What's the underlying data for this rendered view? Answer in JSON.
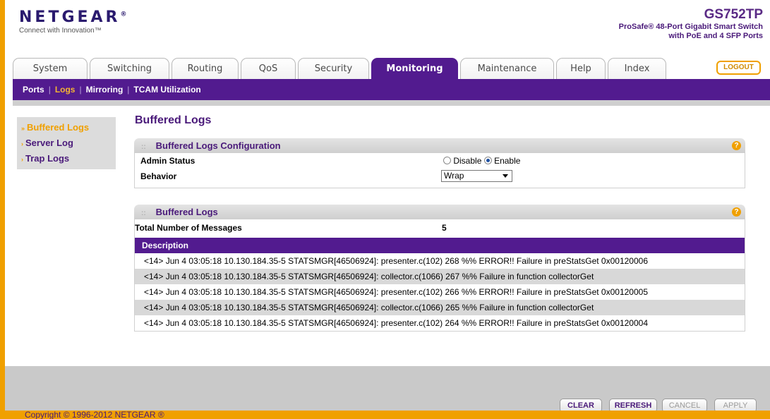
{
  "header": {
    "brand": "NETGEAR",
    "brand_mark": "®",
    "tagline": "Connect with Innovation™",
    "model": "GS752TP",
    "model_desc_1": "ProSafe® 48-Port Gigabit Smart Switch",
    "model_desc_2": "with PoE and 4 SFP Ports"
  },
  "tabs": [
    "System",
    "Switching",
    "Routing",
    "QoS",
    "Security",
    "Monitoring",
    "Maintenance",
    "Help",
    "Index"
  ],
  "active_tab": "Monitoring",
  "logout_label": "LOGOUT",
  "subnav": {
    "items": [
      "Ports",
      "Logs",
      "Mirroring",
      "TCAM Utilization"
    ],
    "active": "Logs"
  },
  "left_menu": {
    "items": [
      "Buffered Logs",
      "Server Log",
      "Trap Logs"
    ],
    "active": "Buffered Logs"
  },
  "page_title": "Buffered Logs",
  "config_section": {
    "title": "Buffered Logs Configuration",
    "admin_status_label": "Admin Status",
    "disable_label": "Disable",
    "enable_label": "Enable",
    "admin_status_value": "Enable",
    "behavior_label": "Behavior",
    "behavior_value": "Wrap"
  },
  "logs_section": {
    "title": "Buffered Logs",
    "total_label": "Total Number of Messages",
    "total_value": "5",
    "description_header": "Description",
    "rows": [
      "<14> Jun 4 03:05:18 10.130.184.35-5 STATSMGR[46506924]: presenter.c(102) 268 %% ERROR!! Failure in preStatsGet 0x00120006",
      "<14> Jun 4 03:05:18 10.130.184.35-5 STATSMGR[46506924]: collector.c(1066) 267 %% Failure in function collectorGet",
      "<14> Jun 4 03:05:18 10.130.184.35-5 STATSMGR[46506924]: presenter.c(102) 266 %% ERROR!! Failure in preStatsGet 0x00120005",
      "<14> Jun 4 03:05:18 10.130.184.35-5 STATSMGR[46506924]: collector.c(1066) 265 %% Failure in function collectorGet",
      "<14> Jun 4 03:05:18 10.130.184.35-5 STATSMGR[46506924]: presenter.c(102) 264 %% ERROR!! Failure in preStatsGet 0x00120004"
    ]
  },
  "buttons": {
    "clear": "CLEAR",
    "refresh": "REFRESH",
    "cancel": "CANCEL",
    "apply": "APPLY"
  },
  "copyright": "Copyright © 1996-2012 NETGEAR ®",
  "colors": {
    "accent_orange": "#f0a000",
    "brand_purple": "#521b8f"
  }
}
